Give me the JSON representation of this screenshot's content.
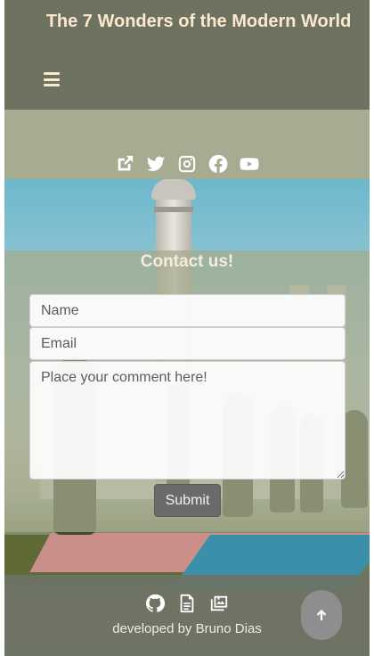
{
  "header": {
    "title": "The 7 Wonders of the Modern World",
    "menu_icon": "hamburger-menu-icon"
  },
  "social": {
    "icons": [
      "external-link-icon",
      "twitter-icon",
      "instagram-icon",
      "facebook-icon",
      "youtube-icon"
    ]
  },
  "contact": {
    "title": "Contact us!",
    "name_placeholder": "Name",
    "email_placeholder": "Email",
    "comment_placeholder": "Place your comment here!",
    "submit_label": "Submit"
  },
  "footer": {
    "icons": [
      "github-icon",
      "document-icon",
      "gallery-icon"
    ],
    "credit": "developed by Bruno Dias",
    "scroll_top_icon": "arrow-up-icon"
  },
  "colors": {
    "header_bg": "#6e7260",
    "title_text": "#fbe9cf",
    "strip_bg": "#a6ab92",
    "submit_bg": "#6b6b6b",
    "scroll_top_bg": "#8e8e8e"
  }
}
